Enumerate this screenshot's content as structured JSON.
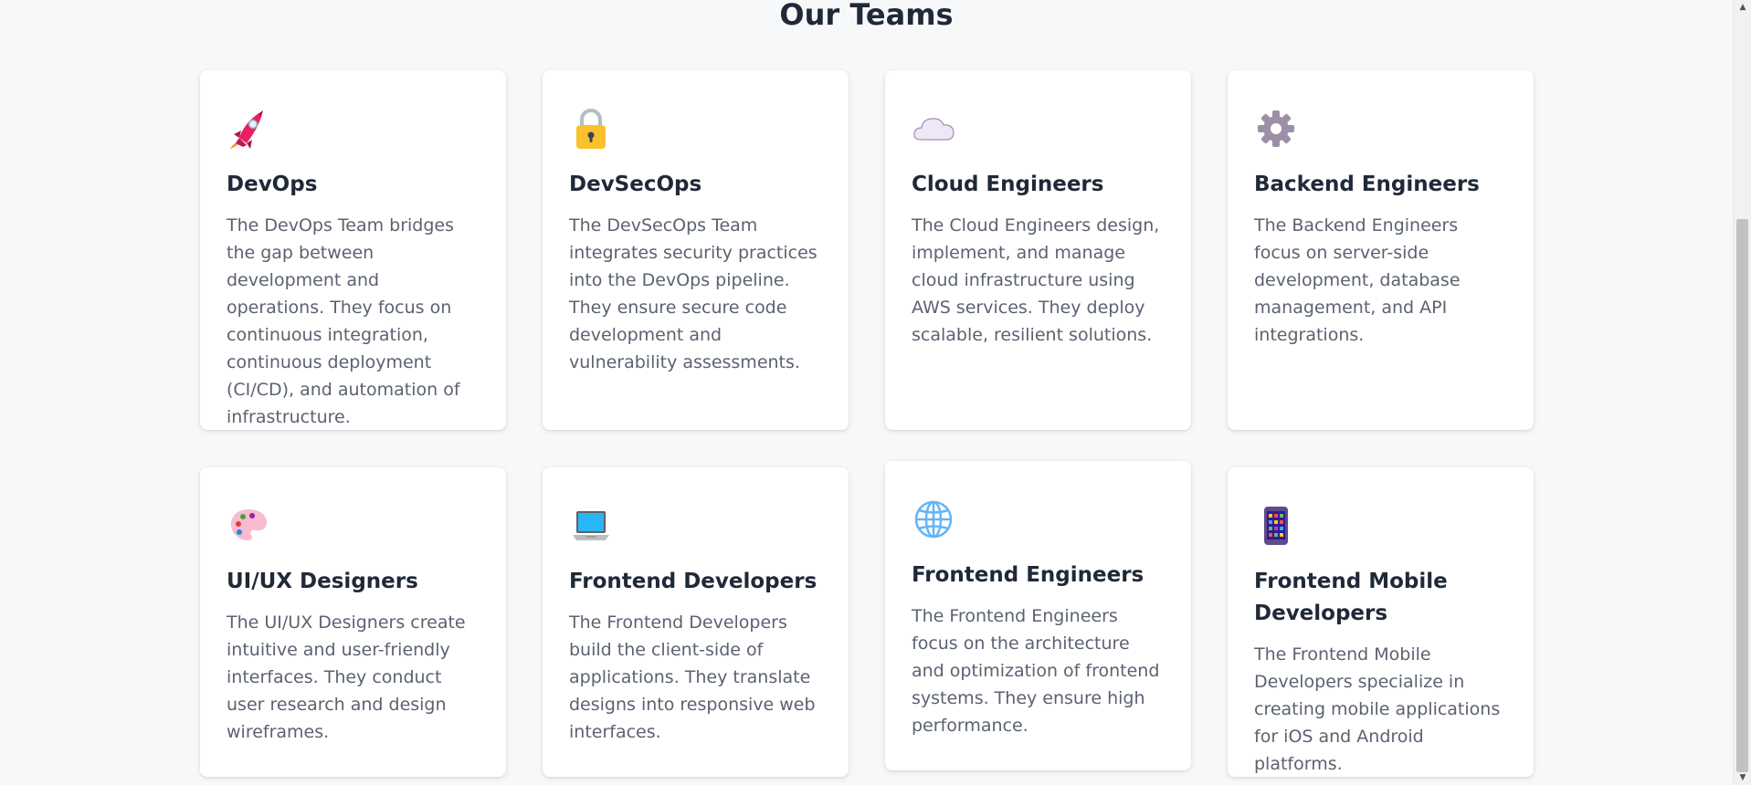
{
  "section": {
    "title": "Our Teams"
  },
  "teams": [
    {
      "icon": "rocket-icon",
      "title": "DevOps",
      "description": "The DevOps Team bridges the gap between development and operations. They focus on continuous integration, continuous deployment (CI/CD), and automation of infrastructure."
    },
    {
      "icon": "lock-icon",
      "title": "DevSecOps",
      "description": "The DevSecOps Team integrates security practices into the DevOps pipeline. They ensure secure code development and vulnerability assessments."
    },
    {
      "icon": "cloud-icon",
      "title": "Cloud Engineers",
      "description": "The Cloud Engineers design, implement, and manage cloud infrastructure using AWS services. They deploy scalable, resilient solutions."
    },
    {
      "icon": "gear-icon",
      "title": "Backend Engineers",
      "description": "The Backend Engineers focus on server-side development, database management, and API integrations."
    },
    {
      "icon": "palette-icon",
      "title": "UI/UX Designers",
      "description": "The UI/UX Designers create intuitive and user-friendly interfaces. They conduct user research and design wireframes."
    },
    {
      "icon": "laptop-icon",
      "title": "Frontend Developers",
      "description": "The Frontend Developers build the client-side of applications. They translate designs into responsive web interfaces."
    },
    {
      "icon": "globe-icon",
      "title": "Frontend Engineers",
      "description": "The Frontend Engineers focus on the architecture and optimization of frontend systems. They ensure high performance."
    },
    {
      "icon": "mobile-phone-icon",
      "title": "Frontend Mobile Developers",
      "description": "The Frontend Mobile Developers specialize in creating mobile applications for iOS and Android platforms."
    }
  ]
}
